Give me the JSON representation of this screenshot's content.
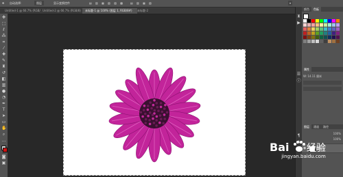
{
  "optionsBar": {
    "items": [
      "自动选择:",
      "图层",
      "显示变换控件"
    ]
  },
  "tabs": [
    {
      "label": "Untitled-1 @ 66.7% (RGB/8)",
      "active": false
    },
    {
      "label": "Untitled-2 @ 66.7% (RGB/8)",
      "active": false
    },
    {
      "label": "未标题-1 @ 100% (图层 1, RGB/8#)",
      "active": true
    },
    {
      "label": "未标题-2",
      "active": false
    }
  ],
  "panels": {
    "color_tabs": [
      "颜色",
      "色板"
    ],
    "layer_tabs": [
      "图层",
      "通道",
      "路径"
    ],
    "properties_title": "属性",
    "properties_row": "W: 14.11 厘米",
    "layer_name": "图层 1",
    "opacity": "100%",
    "fill": "100%"
  },
  "swatchColors": [
    "#ffffff",
    "#000000",
    "#ff0000",
    "#ffff00",
    "#00ff00",
    "#00ffff",
    "#0000ff",
    "#ff00ff",
    "#ff7f00",
    "#f0d0d0",
    "#e8b0b0",
    "#f4a0a0",
    "#f8c080",
    "#fff0a0",
    "#c0f0a0",
    "#a0f0e0",
    "#a0c0f0",
    "#c0a0f0",
    "#e06060",
    "#e08040",
    "#f0d060",
    "#a0d060",
    "#60c080",
    "#40c0c0",
    "#4080d0",
    "#6060c0",
    "#a060c0",
    "#c02020",
    "#c06020",
    "#c0a020",
    "#60a020",
    "#20a060",
    "#208080",
    "#2060a0",
    "#402080",
    "#802080",
    "#801010",
    "#804010",
    "#807010",
    "#406010",
    "#106040",
    "#105050",
    "#103060",
    "#201050",
    "#501050",
    "#808080",
    "#a0a0a0",
    "#c0c0c0",
    "#d8d8d8",
    "#606060",
    "#404040",
    "#c09060",
    "#a07040",
    "#704020"
  ],
  "flower": {
    "petal_color": "#c2249a",
    "center_color": "#3a1030"
  },
  "watermark": {
    "brand": "Bai 经验",
    "url": "jingyan.baidu.com"
  }
}
